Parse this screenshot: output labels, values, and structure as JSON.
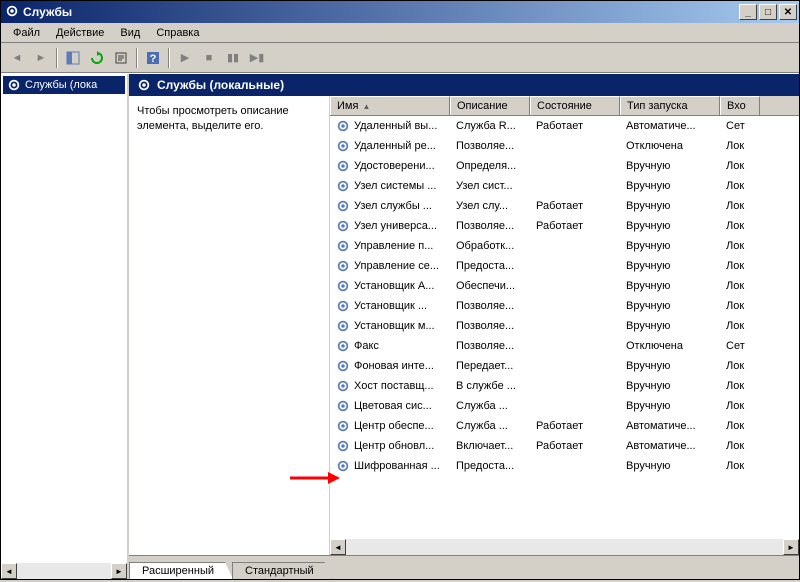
{
  "window": {
    "title": "Службы"
  },
  "menu": {
    "file": "Файл",
    "action": "Действие",
    "view": "Вид",
    "help": "Справка"
  },
  "tree": {
    "root": "Службы (лока"
  },
  "pane": {
    "header": "Службы (локальные)",
    "description": "Чтобы просмотреть описание элемента, выделите его."
  },
  "columns": {
    "name": "Имя",
    "desc": "Описание",
    "state": "Состояние",
    "startup": "Тип запуска",
    "logon": "Вхо"
  },
  "tabs": {
    "extended": "Расширенный",
    "standard": "Стандартный"
  },
  "services": [
    {
      "name": "Удаленный вы...",
      "desc": "Служба R...",
      "state": "Работает",
      "startup": "Автоматиче...",
      "logon": "Сет"
    },
    {
      "name": "Удаленный ре...",
      "desc": "Позволяе...",
      "state": "",
      "startup": "Отключена",
      "logon": "Лок"
    },
    {
      "name": "Удостоверени...",
      "desc": "Определя...",
      "state": "",
      "startup": "Вручную",
      "logon": "Лок"
    },
    {
      "name": "Узел системы ...",
      "desc": "Узел сист...",
      "state": "",
      "startup": "Вручную",
      "logon": "Лок"
    },
    {
      "name": "Узел службы ...",
      "desc": "Узел слу...",
      "state": "Работает",
      "startup": "Вручную",
      "logon": "Лок"
    },
    {
      "name": "Узел универса...",
      "desc": "Позволяе...",
      "state": "Работает",
      "startup": "Вручную",
      "logon": "Лок"
    },
    {
      "name": "Управление п...",
      "desc": "Обработк...",
      "state": "",
      "startup": "Вручную",
      "logon": "Лок"
    },
    {
      "name": "Управление се...",
      "desc": "Предоста...",
      "state": "",
      "startup": "Вручную",
      "logon": "Лок"
    },
    {
      "name": "Установщик A...",
      "desc": "Обеспечи...",
      "state": "",
      "startup": "Вручную",
      "logon": "Лок"
    },
    {
      "name": "Установщик ...",
      "desc": "Позволяе...",
      "state": "",
      "startup": "Вручную",
      "logon": "Лок"
    },
    {
      "name": "Установщик м...",
      "desc": "Позволяе...",
      "state": "",
      "startup": "Вручную",
      "logon": "Лок"
    },
    {
      "name": "Факс",
      "desc": "Позволяе...",
      "state": "",
      "startup": "Отключена",
      "logon": "Сет"
    },
    {
      "name": "Фоновая инте...",
      "desc": "Передает...",
      "state": "",
      "startup": "Вручную",
      "logon": "Лок"
    },
    {
      "name": "Хост поставщ...",
      "desc": "В службе ...",
      "state": "",
      "startup": "Вручную",
      "logon": "Лок"
    },
    {
      "name": "Цветовая сис...",
      "desc": "Служба ...",
      "state": "",
      "startup": "Вручную",
      "logon": "Лок"
    },
    {
      "name": "Центр обеспе...",
      "desc": "Служба ...",
      "state": "Работает",
      "startup": "Автоматиче...",
      "logon": "Лок"
    },
    {
      "name": "Центр обновл...",
      "desc": "Включает...",
      "state": "Работает",
      "startup": "Автоматиче...",
      "logon": "Лок"
    },
    {
      "name": "Шифрованная ...",
      "desc": "Предоста...",
      "state": "",
      "startup": "Вручную",
      "logon": "Лок"
    }
  ],
  "colors": {
    "accent": "#0a246a",
    "panel": "#d4d0c8"
  }
}
